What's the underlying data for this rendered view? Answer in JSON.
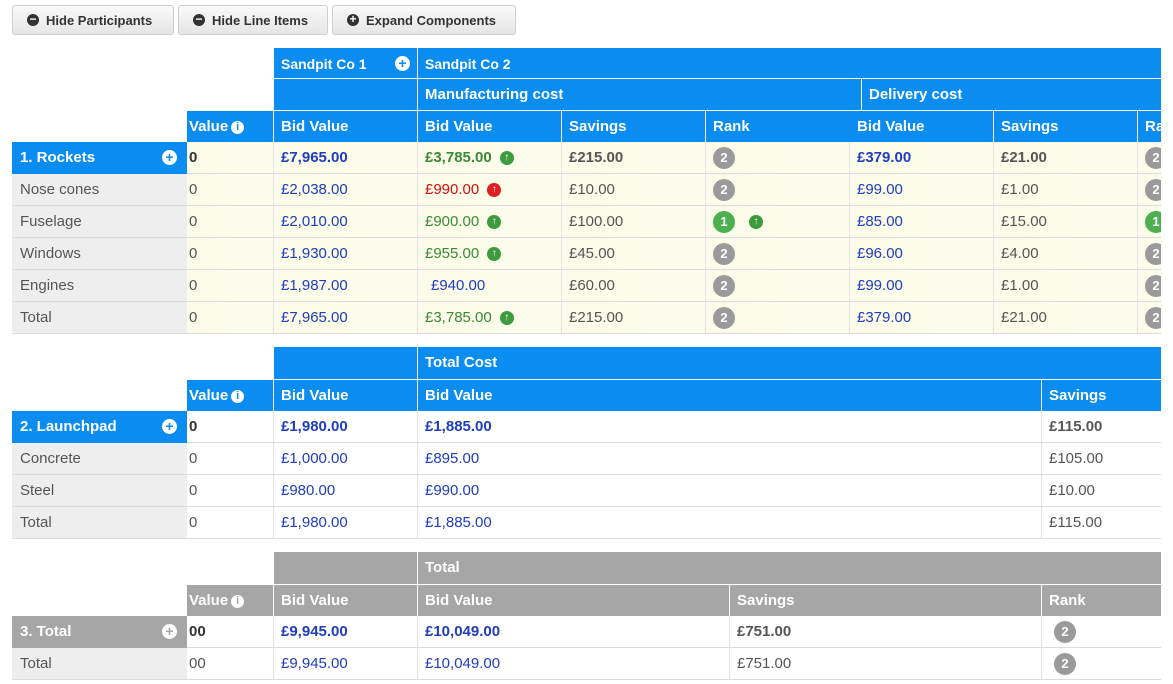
{
  "toolbar": {
    "hide_participants": "Hide Participants",
    "hide_line_items": "Hide Line Items",
    "expand_components": "Expand Components"
  },
  "value_header": "Value",
  "bid_value_header": "Bid Value",
  "savings_header": "Savings",
  "rank_header": "Rank",
  "rank_header_cut": "Ra",
  "participants": [
    "Sandpit Co 1",
    "Sandpit Co 2"
  ],
  "rockets": {
    "groups": [
      "Manufacturing cost",
      "Delivery cost"
    ],
    "section": "1. Rockets",
    "rows": [
      {
        "label": "1. Rockets",
        "value": "0",
        "bid1": "£7,965.00",
        "mbid": "£3,785.00",
        "msav": "£215.00",
        "mrank": "2",
        "dbid": "£379.00",
        "dsav": "£21.00"
      },
      {
        "label": "Nose cones",
        "value": "0",
        "bid1": "£2,038.00",
        "mbid": "£990.00",
        "msav": "£10.00",
        "mrank": "2",
        "dbid": "£99.00",
        "dsav": "£1.00"
      },
      {
        "label": "Fuselage",
        "value": "0",
        "bid1": "£2,010.00",
        "mbid": "£900.00",
        "msav": "£100.00",
        "mrank": "1",
        "dbid": "£85.00",
        "dsav": "£15.00"
      },
      {
        "label": "Windows",
        "value": "0",
        "bid1": "£1,930.00",
        "mbid": "£955.00",
        "msav": "£45.00",
        "mrank": "2",
        "dbid": "£96.00",
        "dsav": "£4.00"
      },
      {
        "label": "Engines",
        "value": "0",
        "bid1": "£1,987.00",
        "mbid": "£940.00",
        "msav": "£60.00",
        "mrank": "2",
        "dbid": "£99.00",
        "dsav": "£1.00"
      },
      {
        "label": "Total",
        "value": "0",
        "bid1": "£7,965.00",
        "mbid": "£3,785.00",
        "msav": "£215.00",
        "mrank": "2",
        "dbid": "£379.00",
        "dsav": "£21.00"
      }
    ]
  },
  "launchpad": {
    "group": "Total Cost",
    "rows": [
      {
        "label": "2. Launchpad",
        "value": "0",
        "bid1": "£1,980.00",
        "bid2": "£1,885.00",
        "sav": "£115.00"
      },
      {
        "label": "Concrete",
        "value": "0",
        "bid1": "£1,000.00",
        "bid2": "£895.00",
        "sav": "£105.00"
      },
      {
        "label": "Steel",
        "value": "0",
        "bid1": "£980.00",
        "bid2": "£990.00",
        "sav": "£10.00"
      },
      {
        "label": "Total",
        "value": "0",
        "bid1": "£1,980.00",
        "bid2": "£1,885.00",
        "sav": "£115.00"
      }
    ]
  },
  "total": {
    "group": "Total",
    "rows": [
      {
        "label": "3. Total",
        "value": "00",
        "bid1": "£9,945.00",
        "bid2": "£10,049.00",
        "sav": "£751.00",
        "rank": "2"
      },
      {
        "label": "Total",
        "value": "00",
        "bid1": "£9,945.00",
        "bid2": "£10,049.00",
        "sav": "£751.00",
        "rank": "2"
      }
    ]
  },
  "colors": {
    "accent": "#0a8cf0",
    "header_gray": "#a6a6a6",
    "value_blue": "#1f3dbd",
    "better_green": "#3a8a3a",
    "worse_red": "#d01010"
  },
  "icons": {
    "minus": "minus-circle-icon",
    "plus": "plus-circle-icon",
    "info": "info-circle-icon",
    "up": "arrow-up-circle-icon"
  }
}
